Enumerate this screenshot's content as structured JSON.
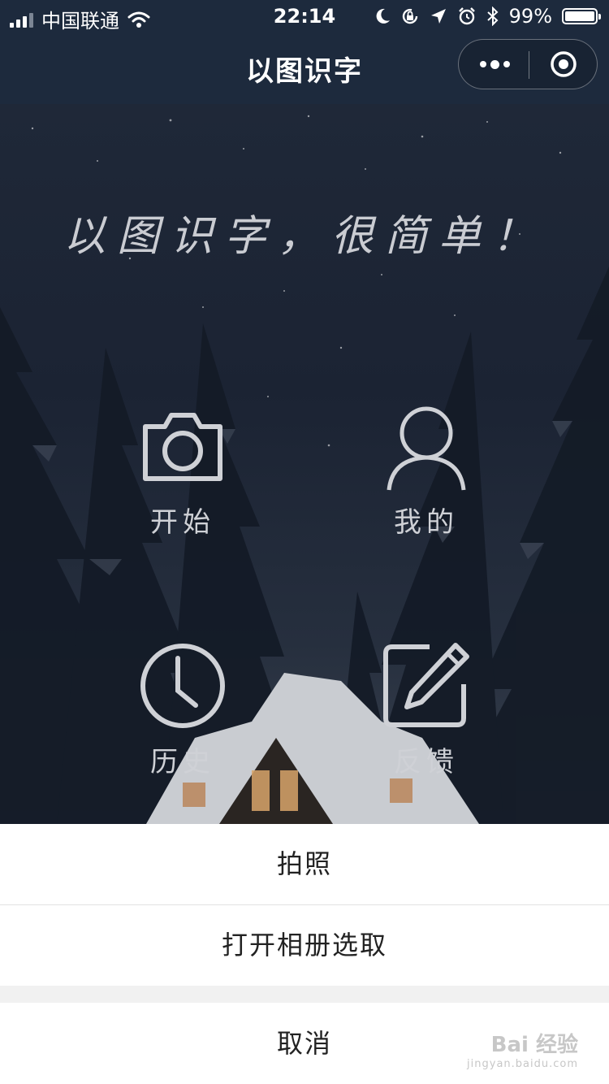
{
  "status_bar": {
    "carrier": "中国联通",
    "time": "22:14",
    "battery": "99%",
    "battery_level": 0.99
  },
  "nav": {
    "title": "以图识字"
  },
  "hero": {
    "slogan": "以图识字，很简单！"
  },
  "menu": [
    {
      "label": "开始",
      "icon": "camera-icon"
    },
    {
      "label": "我的",
      "icon": "user-icon"
    },
    {
      "label": "历史",
      "icon": "clock-icon"
    },
    {
      "label": "反馈",
      "icon": "edit-icon"
    }
  ],
  "action_sheet": {
    "take_photo": "拍照",
    "choose_album": "打开相册选取",
    "cancel": "取消"
  },
  "watermark": {
    "brand": "Bai 经验",
    "url": "jingyan.baidu.com"
  }
}
